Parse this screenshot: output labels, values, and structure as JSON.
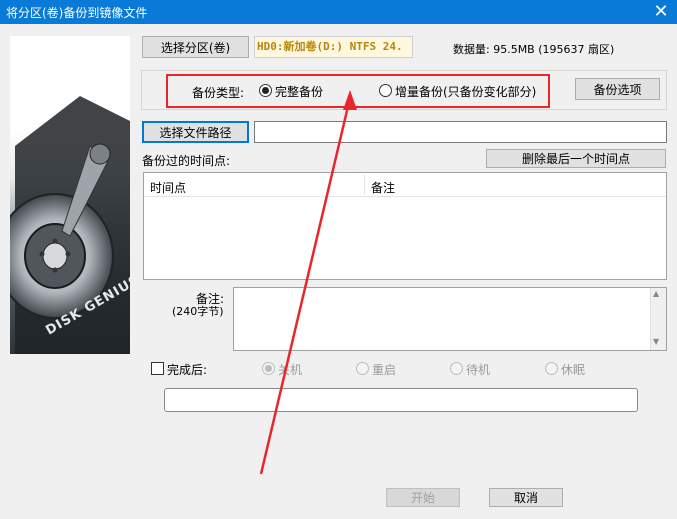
{
  "window": {
    "title": "将分区(卷)备份到镜像文件",
    "close_glyph": "✕"
  },
  "partition": {
    "select_button": "选择分区(卷)",
    "selected_label": "HD0:新加卷(D:) NTFS 24.",
    "data_size": "数据量: 95.5MB (195637 扇区)"
  },
  "backup_type": {
    "label": "备份类型:",
    "options": [
      {
        "label": "完整备份",
        "selected": true
      },
      {
        "label": "增量备份(只备份变化部分)",
        "selected": false
      }
    ],
    "options_button": "备份选项"
  },
  "file_path": {
    "select_button": "选择文件路径",
    "value": ""
  },
  "timepoints": {
    "label": "备份过的时间点:",
    "delete_button": "删除最后一个时间点",
    "columns": [
      "时间点",
      "备注"
    ]
  },
  "note": {
    "label": "备注:",
    "hint": "(240字节)",
    "value": ""
  },
  "on_complete": {
    "label": "完成后:",
    "options": [
      {
        "label": "关机",
        "selected": true
      },
      {
        "label": "重启",
        "selected": false
      },
      {
        "label": "待机",
        "selected": false
      },
      {
        "label": "休眠",
        "selected": false
      }
    ]
  },
  "status_value": "",
  "actions": {
    "start": "开始",
    "cancel": "取消"
  },
  "brand": {
    "logo_text": "DISK GENIUS"
  },
  "colors": {
    "titlebar": "#0a7ad8",
    "annotation": "#e8262b"
  }
}
